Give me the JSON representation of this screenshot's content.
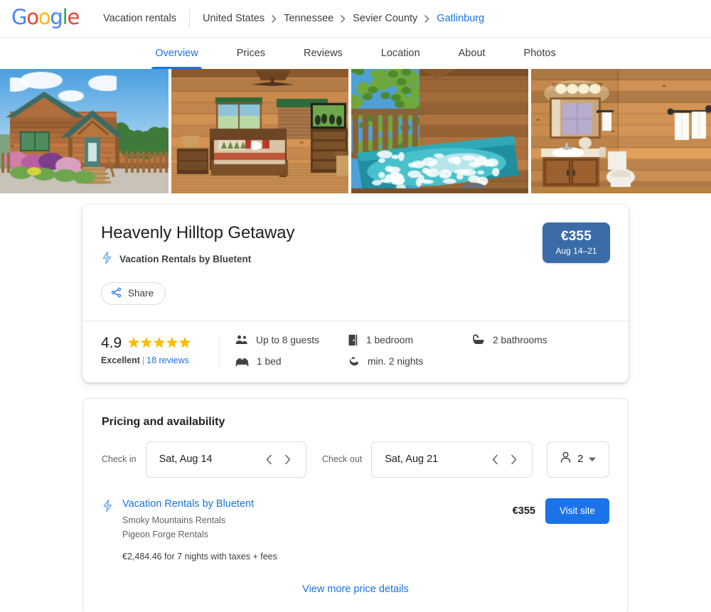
{
  "header": {
    "logo": "Google",
    "logo_letters": [
      {
        "ch": "G",
        "color": "#4285F4"
      },
      {
        "ch": "o",
        "color": "#EA4335"
      },
      {
        "ch": "o",
        "color": "#FBBC05"
      },
      {
        "ch": "g",
        "color": "#4285F4"
      },
      {
        "ch": "l",
        "color": "#34A853"
      },
      {
        "ch": "e",
        "color": "#EA4335"
      }
    ],
    "vertical": "Vacation rentals",
    "breadcrumb": [
      {
        "label": "United States",
        "active": false
      },
      {
        "label": "Tennessee",
        "active": false
      },
      {
        "label": "Sevier County",
        "active": false
      },
      {
        "label": "Gatlinburg",
        "active": true
      }
    ]
  },
  "tabs": [
    {
      "label": "Overview",
      "active": true
    },
    {
      "label": "Prices",
      "active": false
    },
    {
      "label": "Reviews",
      "active": false
    },
    {
      "label": "Location",
      "active": false
    },
    {
      "label": "About",
      "active": false
    },
    {
      "label": "Photos",
      "active": false
    }
  ],
  "photos": [
    {
      "name": "cabin-exterior-photo",
      "alt": "Log cabin exterior with flowering bushes"
    },
    {
      "name": "bedroom-photo",
      "alt": "Knotty pine bedroom with king bed and TV"
    },
    {
      "name": "hot-tub-photo",
      "alt": "Outdoor hot tub on wooden deck"
    },
    {
      "name": "bathroom-photo",
      "alt": "Wood-panelled bathroom with vanity and toilet"
    }
  ],
  "listing": {
    "title": "Heavenly Hilltop Getaway",
    "provider": "Vacation Rentals by Bluetent",
    "share_label": "Share",
    "price_badge": {
      "amount": "€355",
      "dates": "Aug 14–21",
      "color": "#3b6ca8"
    }
  },
  "rating": {
    "score": "4.9",
    "stars": 5,
    "star_color": "#FBBC04",
    "quality": "Excellent",
    "separator": "|",
    "reviews": "18 reviews"
  },
  "facts": [
    {
      "icon": "people-icon",
      "label": "Up to 8 guests"
    },
    {
      "icon": "door-icon",
      "label": "1 bedroom"
    },
    {
      "icon": "bathtub-icon",
      "label": "2 bathrooms"
    },
    {
      "icon": "bed-icon",
      "label": "1 bed"
    },
    {
      "icon": "moon-icon",
      "label": "min. 2 nights"
    },
    {
      "icon": "",
      "label": ""
    }
  ],
  "pricing": {
    "heading": "Pricing and availability",
    "checkin_label": "Check in",
    "checkin_value": "Sat, Aug 14",
    "checkout_label": "Check out",
    "checkout_value": "Sat, Aug 21",
    "guests_value": "2",
    "offer": {
      "partner": "Vacation Rentals by Bluetent",
      "sub_line_1": "Smoky Mountains Rentals",
      "sub_line_2": "Pigeon Forge Rentals",
      "total": "€2,484.46 for 7 nights with taxes + fees",
      "price": "€355",
      "cta": "Visit site"
    },
    "more_details": "View more price details"
  },
  "colors": {
    "accent_blue": "#1a73e8",
    "badge_blue": "#3b6ca8",
    "star_yellow": "#FBBC04",
    "text_primary": "#202124",
    "text_secondary": "#5f6368"
  }
}
